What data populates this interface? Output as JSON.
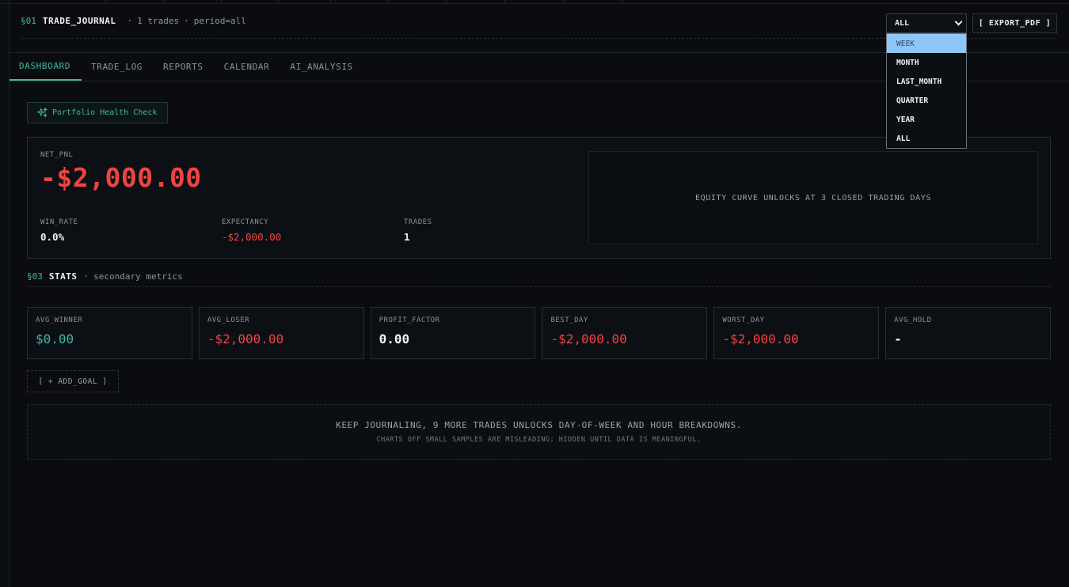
{
  "header": {
    "section_num": "§01",
    "title": "TRADE_JOURNAL",
    "trades_count": "1 trades",
    "period": "period=all",
    "period_select": "ALL",
    "export_label": "[ EXPORT_PDF ]"
  },
  "period_dropdown": {
    "options": [
      "WEEK",
      "MONTH",
      "LAST_MONTH",
      "QUARTER",
      "YEAR",
      "ALL"
    ],
    "highlighted": "WEEK"
  },
  "tabs": [
    "DASHBOARD",
    "TRADE_LOG",
    "REPORTS",
    "CALENDAR",
    "AI_ANALYSIS"
  ],
  "active_tab": "DASHBOARD",
  "health_check": {
    "label": "Portfolio Health Check",
    "icon": "sparkles-icon"
  },
  "hero": {
    "net_pnl_label": "NET_PNL",
    "net_pnl_value": "-$2,000.00",
    "win_rate_label": "WIN_RATE",
    "win_rate_value": "0.0%",
    "expectancy_label": "EXPECTANCY",
    "expectancy_value": "-$2,000.00",
    "trades_label": "TRADES",
    "trades_value": "1",
    "equity_message": "EQUITY CURVE UNLOCKS AT 3 CLOSED TRADING DAYS"
  },
  "stats": {
    "section_num": "§03",
    "title": "STATS",
    "subtitle": "secondary metrics",
    "cards": [
      {
        "label": "AVG_WINNER",
        "value": "$0.00"
      },
      {
        "label": "AVG_LOSER",
        "value": "-$2,000.00"
      },
      {
        "label": "PROFIT_FACTOR",
        "value": "0.00"
      },
      {
        "label": "BEST_DAY",
        "value": "-$2,000.00"
      },
      {
        "label": "WORST_DAY",
        "value": "-$2,000.00"
      },
      {
        "label": "AVG_HOLD",
        "value": "-"
      }
    ]
  },
  "goal_button": "[ + ADD_GOAL ]",
  "notice": {
    "line1": "KEEP JOURNALING, 9 MORE TRADES UNLOCKS DAY-OF-WEEK AND HOUR BREAKDOWNS.",
    "line2": "CHARTS OFF SMALL SAMPLES ARE MISLEADING; HIDDEN UNTIL DATA IS MEANINGFUL."
  },
  "colors": {
    "background": "#0a0c0f",
    "accent_teal": "#3fb9a7",
    "negative_red": "#ef4444",
    "dropdown_highlight": "#8ec5f8"
  }
}
